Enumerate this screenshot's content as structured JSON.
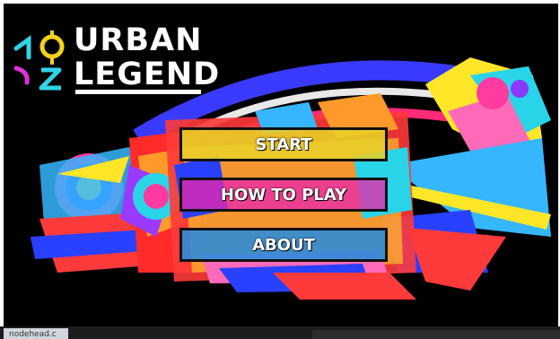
{
  "logo": {
    "line1": "URBAN",
    "line2": "LEGEND"
  },
  "menu": {
    "start": "START",
    "how_to_play": "HOW TO PLAY",
    "about": "ABOUT"
  },
  "taskbar": {
    "tab_label": "nodehead.c"
  },
  "colors": {
    "background": "#000000",
    "start_button": "#e8d228",
    "how_to_play_button": "#e828aa",
    "about_button": "#288cdc",
    "logo_cyan": "#2fd4e8",
    "logo_magenta": "#e030d8",
    "logo_yellow": "#f2d11c"
  }
}
